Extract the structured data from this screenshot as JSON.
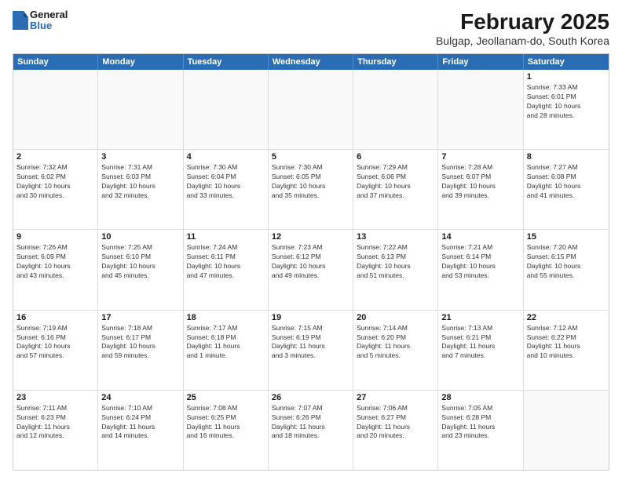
{
  "header": {
    "logo_general": "General",
    "logo_blue": "Blue",
    "title": "February 2025",
    "subtitle": "Bulgap, Jeollanam-do, South Korea"
  },
  "days_of_week": [
    "Sunday",
    "Monday",
    "Tuesday",
    "Wednesday",
    "Thursday",
    "Friday",
    "Saturday"
  ],
  "weeks": [
    [
      {
        "day": "",
        "info": ""
      },
      {
        "day": "",
        "info": ""
      },
      {
        "day": "",
        "info": ""
      },
      {
        "day": "",
        "info": ""
      },
      {
        "day": "",
        "info": ""
      },
      {
        "day": "",
        "info": ""
      },
      {
        "day": "1",
        "info": "Sunrise: 7:33 AM\nSunset: 6:01 PM\nDaylight: 10 hours\nand 28 minutes."
      }
    ],
    [
      {
        "day": "2",
        "info": "Sunrise: 7:32 AM\nSunset: 6:02 PM\nDaylight: 10 hours\nand 30 minutes."
      },
      {
        "day": "3",
        "info": "Sunrise: 7:31 AM\nSunset: 6:03 PM\nDaylight: 10 hours\nand 32 minutes."
      },
      {
        "day": "4",
        "info": "Sunrise: 7:30 AM\nSunset: 6:04 PM\nDaylight: 10 hours\nand 33 minutes."
      },
      {
        "day": "5",
        "info": "Sunrise: 7:30 AM\nSunset: 6:05 PM\nDaylight: 10 hours\nand 35 minutes."
      },
      {
        "day": "6",
        "info": "Sunrise: 7:29 AM\nSunset: 6:06 PM\nDaylight: 10 hours\nand 37 minutes."
      },
      {
        "day": "7",
        "info": "Sunrise: 7:28 AM\nSunset: 6:07 PM\nDaylight: 10 hours\nand 39 minutes."
      },
      {
        "day": "8",
        "info": "Sunrise: 7:27 AM\nSunset: 6:08 PM\nDaylight: 10 hours\nand 41 minutes."
      }
    ],
    [
      {
        "day": "9",
        "info": "Sunrise: 7:26 AM\nSunset: 6:09 PM\nDaylight: 10 hours\nand 43 minutes."
      },
      {
        "day": "10",
        "info": "Sunrise: 7:25 AM\nSunset: 6:10 PM\nDaylight: 10 hours\nand 45 minutes."
      },
      {
        "day": "11",
        "info": "Sunrise: 7:24 AM\nSunset: 6:11 PM\nDaylight: 10 hours\nand 47 minutes."
      },
      {
        "day": "12",
        "info": "Sunrise: 7:23 AM\nSunset: 6:12 PM\nDaylight: 10 hours\nand 49 minutes."
      },
      {
        "day": "13",
        "info": "Sunrise: 7:22 AM\nSunset: 6:13 PM\nDaylight: 10 hours\nand 51 minutes."
      },
      {
        "day": "14",
        "info": "Sunrise: 7:21 AM\nSunset: 6:14 PM\nDaylight: 10 hours\nand 53 minutes."
      },
      {
        "day": "15",
        "info": "Sunrise: 7:20 AM\nSunset: 6:15 PM\nDaylight: 10 hours\nand 55 minutes."
      }
    ],
    [
      {
        "day": "16",
        "info": "Sunrise: 7:19 AM\nSunset: 6:16 PM\nDaylight: 10 hours\nand 57 minutes."
      },
      {
        "day": "17",
        "info": "Sunrise: 7:18 AM\nSunset: 6:17 PM\nDaylight: 10 hours\nand 59 minutes."
      },
      {
        "day": "18",
        "info": "Sunrise: 7:17 AM\nSunset: 6:18 PM\nDaylight: 11 hours\nand 1 minute."
      },
      {
        "day": "19",
        "info": "Sunrise: 7:15 AM\nSunset: 6:19 PM\nDaylight: 11 hours\nand 3 minutes."
      },
      {
        "day": "20",
        "info": "Sunrise: 7:14 AM\nSunset: 6:20 PM\nDaylight: 11 hours\nand 5 minutes."
      },
      {
        "day": "21",
        "info": "Sunrise: 7:13 AM\nSunset: 6:21 PM\nDaylight: 11 hours\nand 7 minutes."
      },
      {
        "day": "22",
        "info": "Sunrise: 7:12 AM\nSunset: 6:22 PM\nDaylight: 11 hours\nand 10 minutes."
      }
    ],
    [
      {
        "day": "23",
        "info": "Sunrise: 7:11 AM\nSunset: 6:23 PM\nDaylight: 11 hours\nand 12 minutes."
      },
      {
        "day": "24",
        "info": "Sunrise: 7:10 AM\nSunset: 6:24 PM\nDaylight: 11 hours\nand 14 minutes."
      },
      {
        "day": "25",
        "info": "Sunrise: 7:08 AM\nSunset: 6:25 PM\nDaylight: 11 hours\nand 16 minutes."
      },
      {
        "day": "26",
        "info": "Sunrise: 7:07 AM\nSunset: 6:26 PM\nDaylight: 11 hours\nand 18 minutes."
      },
      {
        "day": "27",
        "info": "Sunrise: 7:06 AM\nSunset: 6:27 PM\nDaylight: 11 hours\nand 20 minutes."
      },
      {
        "day": "28",
        "info": "Sunrise: 7:05 AM\nSunset: 6:28 PM\nDaylight: 11 hours\nand 23 minutes."
      },
      {
        "day": "",
        "info": ""
      }
    ]
  ]
}
